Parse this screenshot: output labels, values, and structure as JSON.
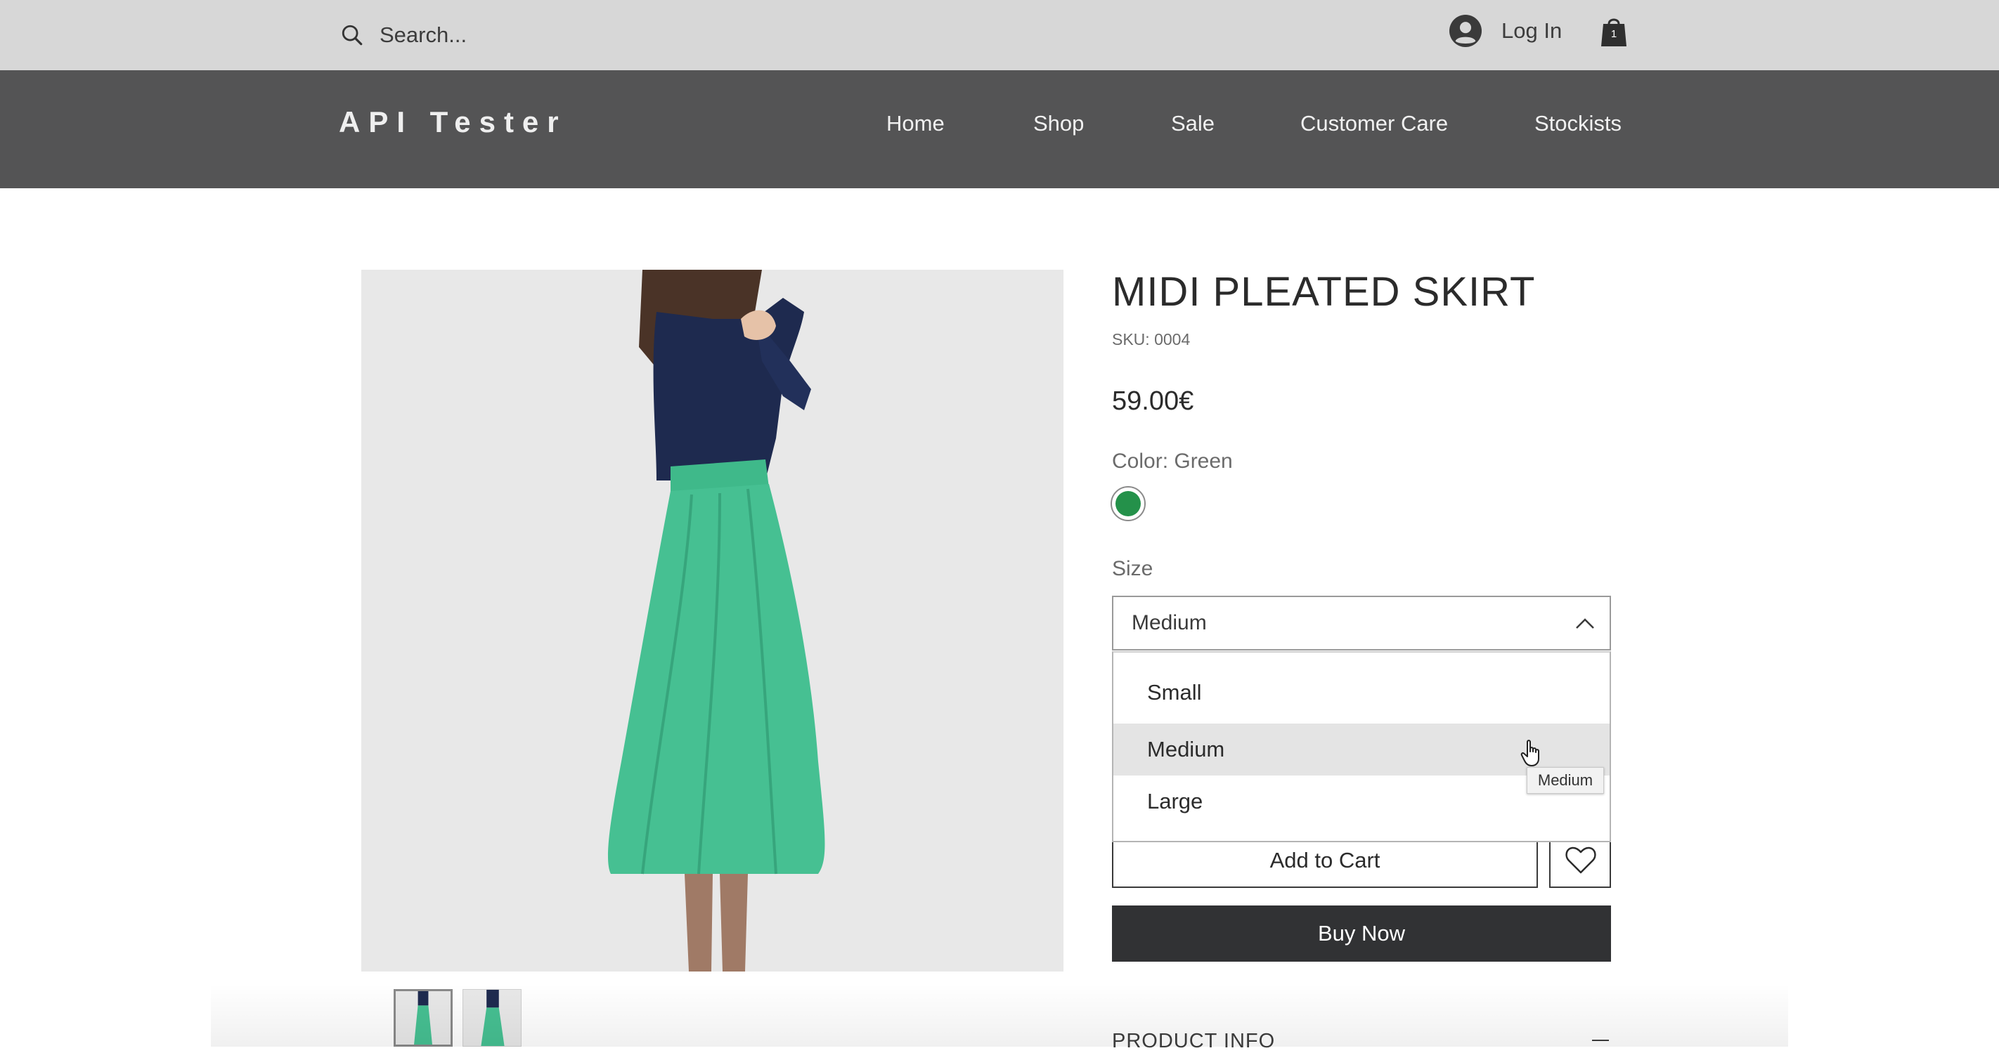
{
  "topbar": {
    "search_placeholder": "Search...",
    "login_label": "Log In",
    "cart_count": "1"
  },
  "nav": {
    "brand": "API Tester",
    "items": [
      "Home",
      "Shop",
      "Sale",
      "Customer Care",
      "Stockists"
    ]
  },
  "product": {
    "title": "MIDI PLEATED SKIRT",
    "sku": "SKU: 0004",
    "price": "59.00€",
    "color_label": "Color: Green",
    "color_hex": "#24914a",
    "size_label": "Size",
    "size_selected": "Medium",
    "size_options": [
      "Small",
      "Medium",
      "Large"
    ],
    "highlighted_option": "Medium",
    "tooltip": "Medium",
    "add_to_cart": "Add to Cart",
    "buy_now": "Buy Now",
    "product_info": "PRODUCT INFO"
  },
  "icons": {
    "search": "search-icon",
    "user": "user-icon",
    "cart": "cart-icon",
    "chevron": "chevron-up-icon",
    "heart": "heart-icon",
    "collapse": "minus-icon"
  },
  "colors": {
    "topbar": "#d7d7d7",
    "navbar": "#545455",
    "buy_now": "#313234",
    "image_bg": "#e8e8e8"
  }
}
